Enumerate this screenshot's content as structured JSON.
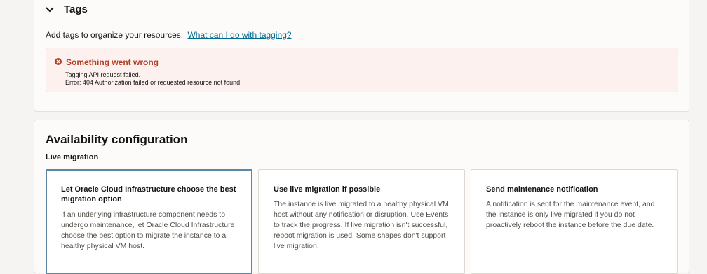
{
  "tags": {
    "title": "Tags",
    "description": "Add tags to organize your resources.",
    "help_link": "What can I do with tagging?",
    "error": {
      "title": "Something went wrong",
      "line1": "Tagging API request failed.",
      "line2": "Error: 404 Authorization failed or requested resource not found."
    }
  },
  "availability": {
    "title": "Availability configuration",
    "live_migration_label": "Live migration",
    "options": [
      {
        "title": "Let Oracle Cloud Infrastructure choose the best migration option",
        "description": "If an underlying infrastructure component needs to undergo maintenance, let Oracle Cloud Infrastructure choose the best option to migrate the instance to a healthy physical VM host.",
        "selected": true
      },
      {
        "title": "Use live migration if possible",
        "description": "The instance is live migrated to a healthy physical VM host without any notification or disruption. Use Events to track the progress. If live migration isn't successful, reboot migration is used. Some shapes don't support live migration.",
        "selected": false
      },
      {
        "title": "Send maintenance notification",
        "description": "A notification is sent for the maintenance event, and the instance is only live migrated if you do not proactively reboot the instance before the due date.",
        "selected": false
      }
    ]
  },
  "colors": {
    "link": "#006b8f",
    "error": "#b53d24",
    "selected_border": "#5b86a5"
  },
  "icons": {
    "collapse": "chevron-down-icon",
    "error": "error-circle-icon"
  }
}
